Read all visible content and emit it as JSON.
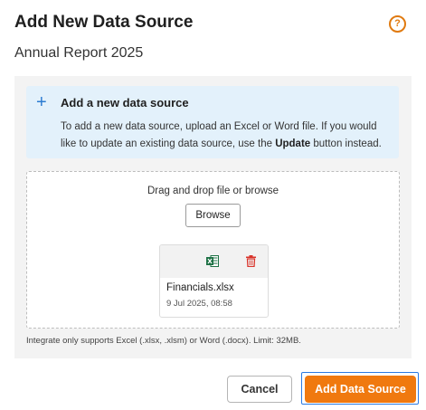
{
  "dialog": {
    "title": "Add New Data Source",
    "subtitle": "Annual Report 2025",
    "help_icon": "?"
  },
  "info": {
    "icon": "+",
    "title": "Add a new data source",
    "text_before": "To add a new data source, upload an Excel or Word file. If you would like to update an existing data source, use the ",
    "text_bold": "Update",
    "text_after": " button instead."
  },
  "dropzone": {
    "text": "Drag and drop file or browse",
    "browse_label": "Browse"
  },
  "file": {
    "name": "Financials.xlsx",
    "date": "9 Jul 2025, 08:58",
    "type_icon": "excel-icon",
    "delete_icon": "trash-icon"
  },
  "note": "Integrate only supports Excel (.xlsx, .xlsm) or Word (.docx). Limit: 32MB.",
  "actions": {
    "cancel_label": "Cancel",
    "add_label": "Add Data Source"
  },
  "colors": {
    "accent": "#f0790f",
    "info_background": "#e3f1fb",
    "info_icon": "#2b7bd1",
    "excel_green": "#1e7145",
    "delete_red": "#d9342b",
    "focus_ring": "#2a7ae2"
  }
}
